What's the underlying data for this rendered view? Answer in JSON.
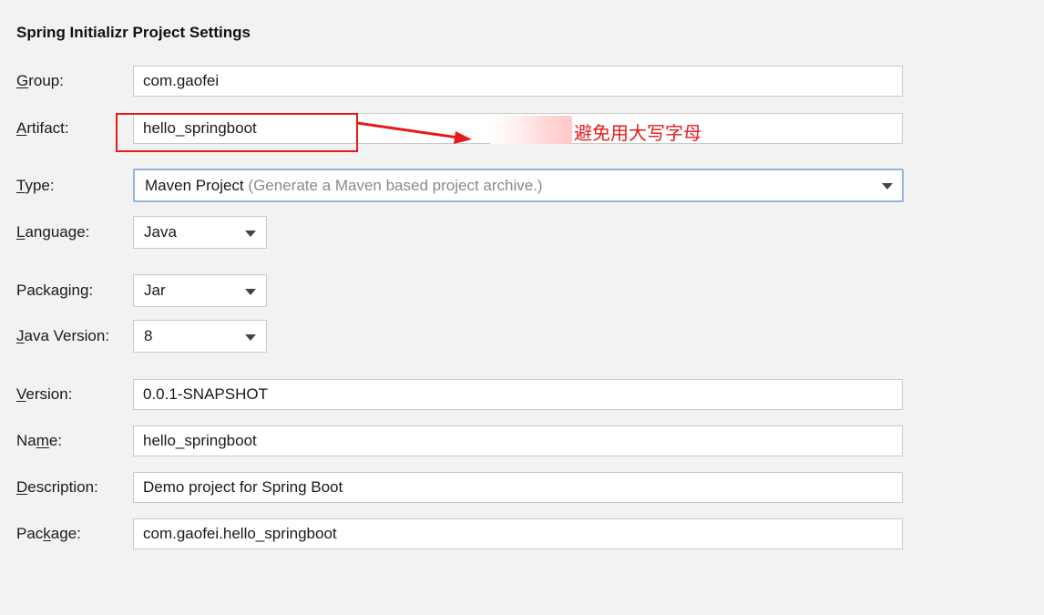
{
  "title": "Spring Initializr Project Settings",
  "fields": {
    "group": {
      "label_pre": "",
      "label_u": "G",
      "label_post": "roup:",
      "value": "com.gaofei"
    },
    "artifact": {
      "label_pre": "",
      "label_u": "A",
      "label_post": "rtifact:",
      "value": "hello_springboot"
    },
    "version": {
      "label_pre": "",
      "label_u": "V",
      "label_post": "ersion:",
      "value": "0.0.1-SNAPSHOT"
    },
    "name": {
      "label_pre": "Na",
      "label_u": "m",
      "label_post": "e:",
      "value": "hello_springboot"
    },
    "description": {
      "label_pre": "",
      "label_u": "D",
      "label_post": "escription:",
      "value": "Demo project for Spring Boot"
    },
    "package": {
      "label_pre": "Pac",
      "label_u": "k",
      "label_post": "age:",
      "value": "com.gaofei.hello_springboot"
    }
  },
  "type": {
    "label_pre": "",
    "label_u": "T",
    "label_post": "ype:",
    "value": "Maven Project",
    "hint": "(Generate a Maven based project archive.)"
  },
  "language": {
    "label_pre": "",
    "label_u": "L",
    "label_post": "anguage:",
    "value": "Java"
  },
  "packaging": {
    "label_pre": "Packa",
    "label_u": "g",
    "label_post": "ing:",
    "value": "Jar"
  },
  "java_version": {
    "label_pre": "",
    "label_u": "J",
    "label_post": "ava Version:",
    "value": "8"
  },
  "annotation": {
    "text": "避免用大写字母",
    "color": "#e8191b"
  },
  "colors": {
    "focus_border": "#8fb4e0",
    "annotation_red": "#e8191b",
    "background": "#f2f2f2"
  }
}
